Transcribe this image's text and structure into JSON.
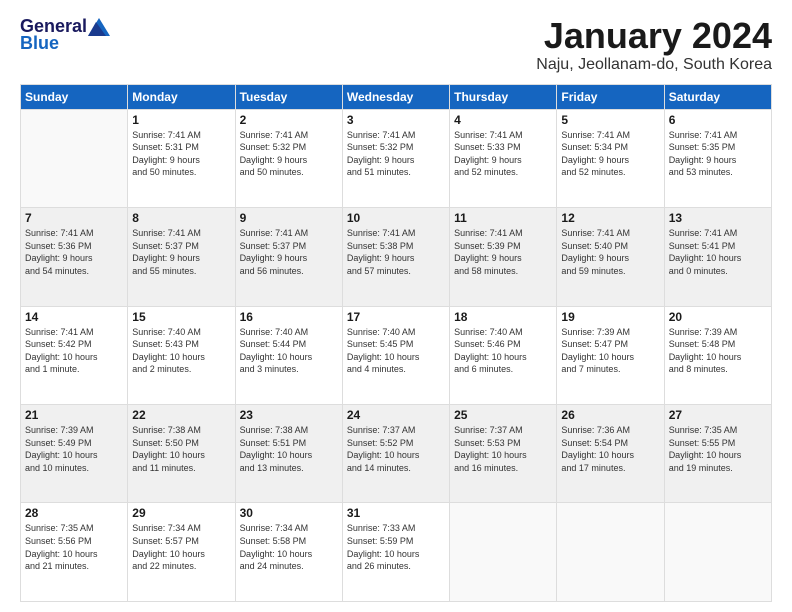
{
  "logo": {
    "general": "General",
    "blue": "Blue"
  },
  "title": "January 2024",
  "location": "Naju, Jeollanam-do, South Korea",
  "days_of_week": [
    "Sunday",
    "Monday",
    "Tuesday",
    "Wednesday",
    "Thursday",
    "Friday",
    "Saturday"
  ],
  "weeks": [
    [
      {
        "day": "",
        "info": ""
      },
      {
        "day": "1",
        "info": "Sunrise: 7:41 AM\nSunset: 5:31 PM\nDaylight: 9 hours\nand 50 minutes."
      },
      {
        "day": "2",
        "info": "Sunrise: 7:41 AM\nSunset: 5:32 PM\nDaylight: 9 hours\nand 50 minutes."
      },
      {
        "day": "3",
        "info": "Sunrise: 7:41 AM\nSunset: 5:32 PM\nDaylight: 9 hours\nand 51 minutes."
      },
      {
        "day": "4",
        "info": "Sunrise: 7:41 AM\nSunset: 5:33 PM\nDaylight: 9 hours\nand 52 minutes."
      },
      {
        "day": "5",
        "info": "Sunrise: 7:41 AM\nSunset: 5:34 PM\nDaylight: 9 hours\nand 52 minutes."
      },
      {
        "day": "6",
        "info": "Sunrise: 7:41 AM\nSunset: 5:35 PM\nDaylight: 9 hours\nand 53 minutes."
      }
    ],
    [
      {
        "day": "7",
        "info": "Sunrise: 7:41 AM\nSunset: 5:36 PM\nDaylight: 9 hours\nand 54 minutes."
      },
      {
        "day": "8",
        "info": "Sunrise: 7:41 AM\nSunset: 5:37 PM\nDaylight: 9 hours\nand 55 minutes."
      },
      {
        "day": "9",
        "info": "Sunrise: 7:41 AM\nSunset: 5:37 PM\nDaylight: 9 hours\nand 56 minutes."
      },
      {
        "day": "10",
        "info": "Sunrise: 7:41 AM\nSunset: 5:38 PM\nDaylight: 9 hours\nand 57 minutes."
      },
      {
        "day": "11",
        "info": "Sunrise: 7:41 AM\nSunset: 5:39 PM\nDaylight: 9 hours\nand 58 minutes."
      },
      {
        "day": "12",
        "info": "Sunrise: 7:41 AM\nSunset: 5:40 PM\nDaylight: 9 hours\nand 59 minutes."
      },
      {
        "day": "13",
        "info": "Sunrise: 7:41 AM\nSunset: 5:41 PM\nDaylight: 10 hours\nand 0 minutes."
      }
    ],
    [
      {
        "day": "14",
        "info": "Sunrise: 7:41 AM\nSunset: 5:42 PM\nDaylight: 10 hours\nand 1 minute."
      },
      {
        "day": "15",
        "info": "Sunrise: 7:40 AM\nSunset: 5:43 PM\nDaylight: 10 hours\nand 2 minutes."
      },
      {
        "day": "16",
        "info": "Sunrise: 7:40 AM\nSunset: 5:44 PM\nDaylight: 10 hours\nand 3 minutes."
      },
      {
        "day": "17",
        "info": "Sunrise: 7:40 AM\nSunset: 5:45 PM\nDaylight: 10 hours\nand 4 minutes."
      },
      {
        "day": "18",
        "info": "Sunrise: 7:40 AM\nSunset: 5:46 PM\nDaylight: 10 hours\nand 6 minutes."
      },
      {
        "day": "19",
        "info": "Sunrise: 7:39 AM\nSunset: 5:47 PM\nDaylight: 10 hours\nand 7 minutes."
      },
      {
        "day": "20",
        "info": "Sunrise: 7:39 AM\nSunset: 5:48 PM\nDaylight: 10 hours\nand 8 minutes."
      }
    ],
    [
      {
        "day": "21",
        "info": "Sunrise: 7:39 AM\nSunset: 5:49 PM\nDaylight: 10 hours\nand 10 minutes."
      },
      {
        "day": "22",
        "info": "Sunrise: 7:38 AM\nSunset: 5:50 PM\nDaylight: 10 hours\nand 11 minutes."
      },
      {
        "day": "23",
        "info": "Sunrise: 7:38 AM\nSunset: 5:51 PM\nDaylight: 10 hours\nand 13 minutes."
      },
      {
        "day": "24",
        "info": "Sunrise: 7:37 AM\nSunset: 5:52 PM\nDaylight: 10 hours\nand 14 minutes."
      },
      {
        "day": "25",
        "info": "Sunrise: 7:37 AM\nSunset: 5:53 PM\nDaylight: 10 hours\nand 16 minutes."
      },
      {
        "day": "26",
        "info": "Sunrise: 7:36 AM\nSunset: 5:54 PM\nDaylight: 10 hours\nand 17 minutes."
      },
      {
        "day": "27",
        "info": "Sunrise: 7:35 AM\nSunset: 5:55 PM\nDaylight: 10 hours\nand 19 minutes."
      }
    ],
    [
      {
        "day": "28",
        "info": "Sunrise: 7:35 AM\nSunset: 5:56 PM\nDaylight: 10 hours\nand 21 minutes."
      },
      {
        "day": "29",
        "info": "Sunrise: 7:34 AM\nSunset: 5:57 PM\nDaylight: 10 hours\nand 22 minutes."
      },
      {
        "day": "30",
        "info": "Sunrise: 7:34 AM\nSunset: 5:58 PM\nDaylight: 10 hours\nand 24 minutes."
      },
      {
        "day": "31",
        "info": "Sunrise: 7:33 AM\nSunset: 5:59 PM\nDaylight: 10 hours\nand 26 minutes."
      },
      {
        "day": "",
        "info": ""
      },
      {
        "day": "",
        "info": ""
      },
      {
        "day": "",
        "info": ""
      }
    ]
  ]
}
